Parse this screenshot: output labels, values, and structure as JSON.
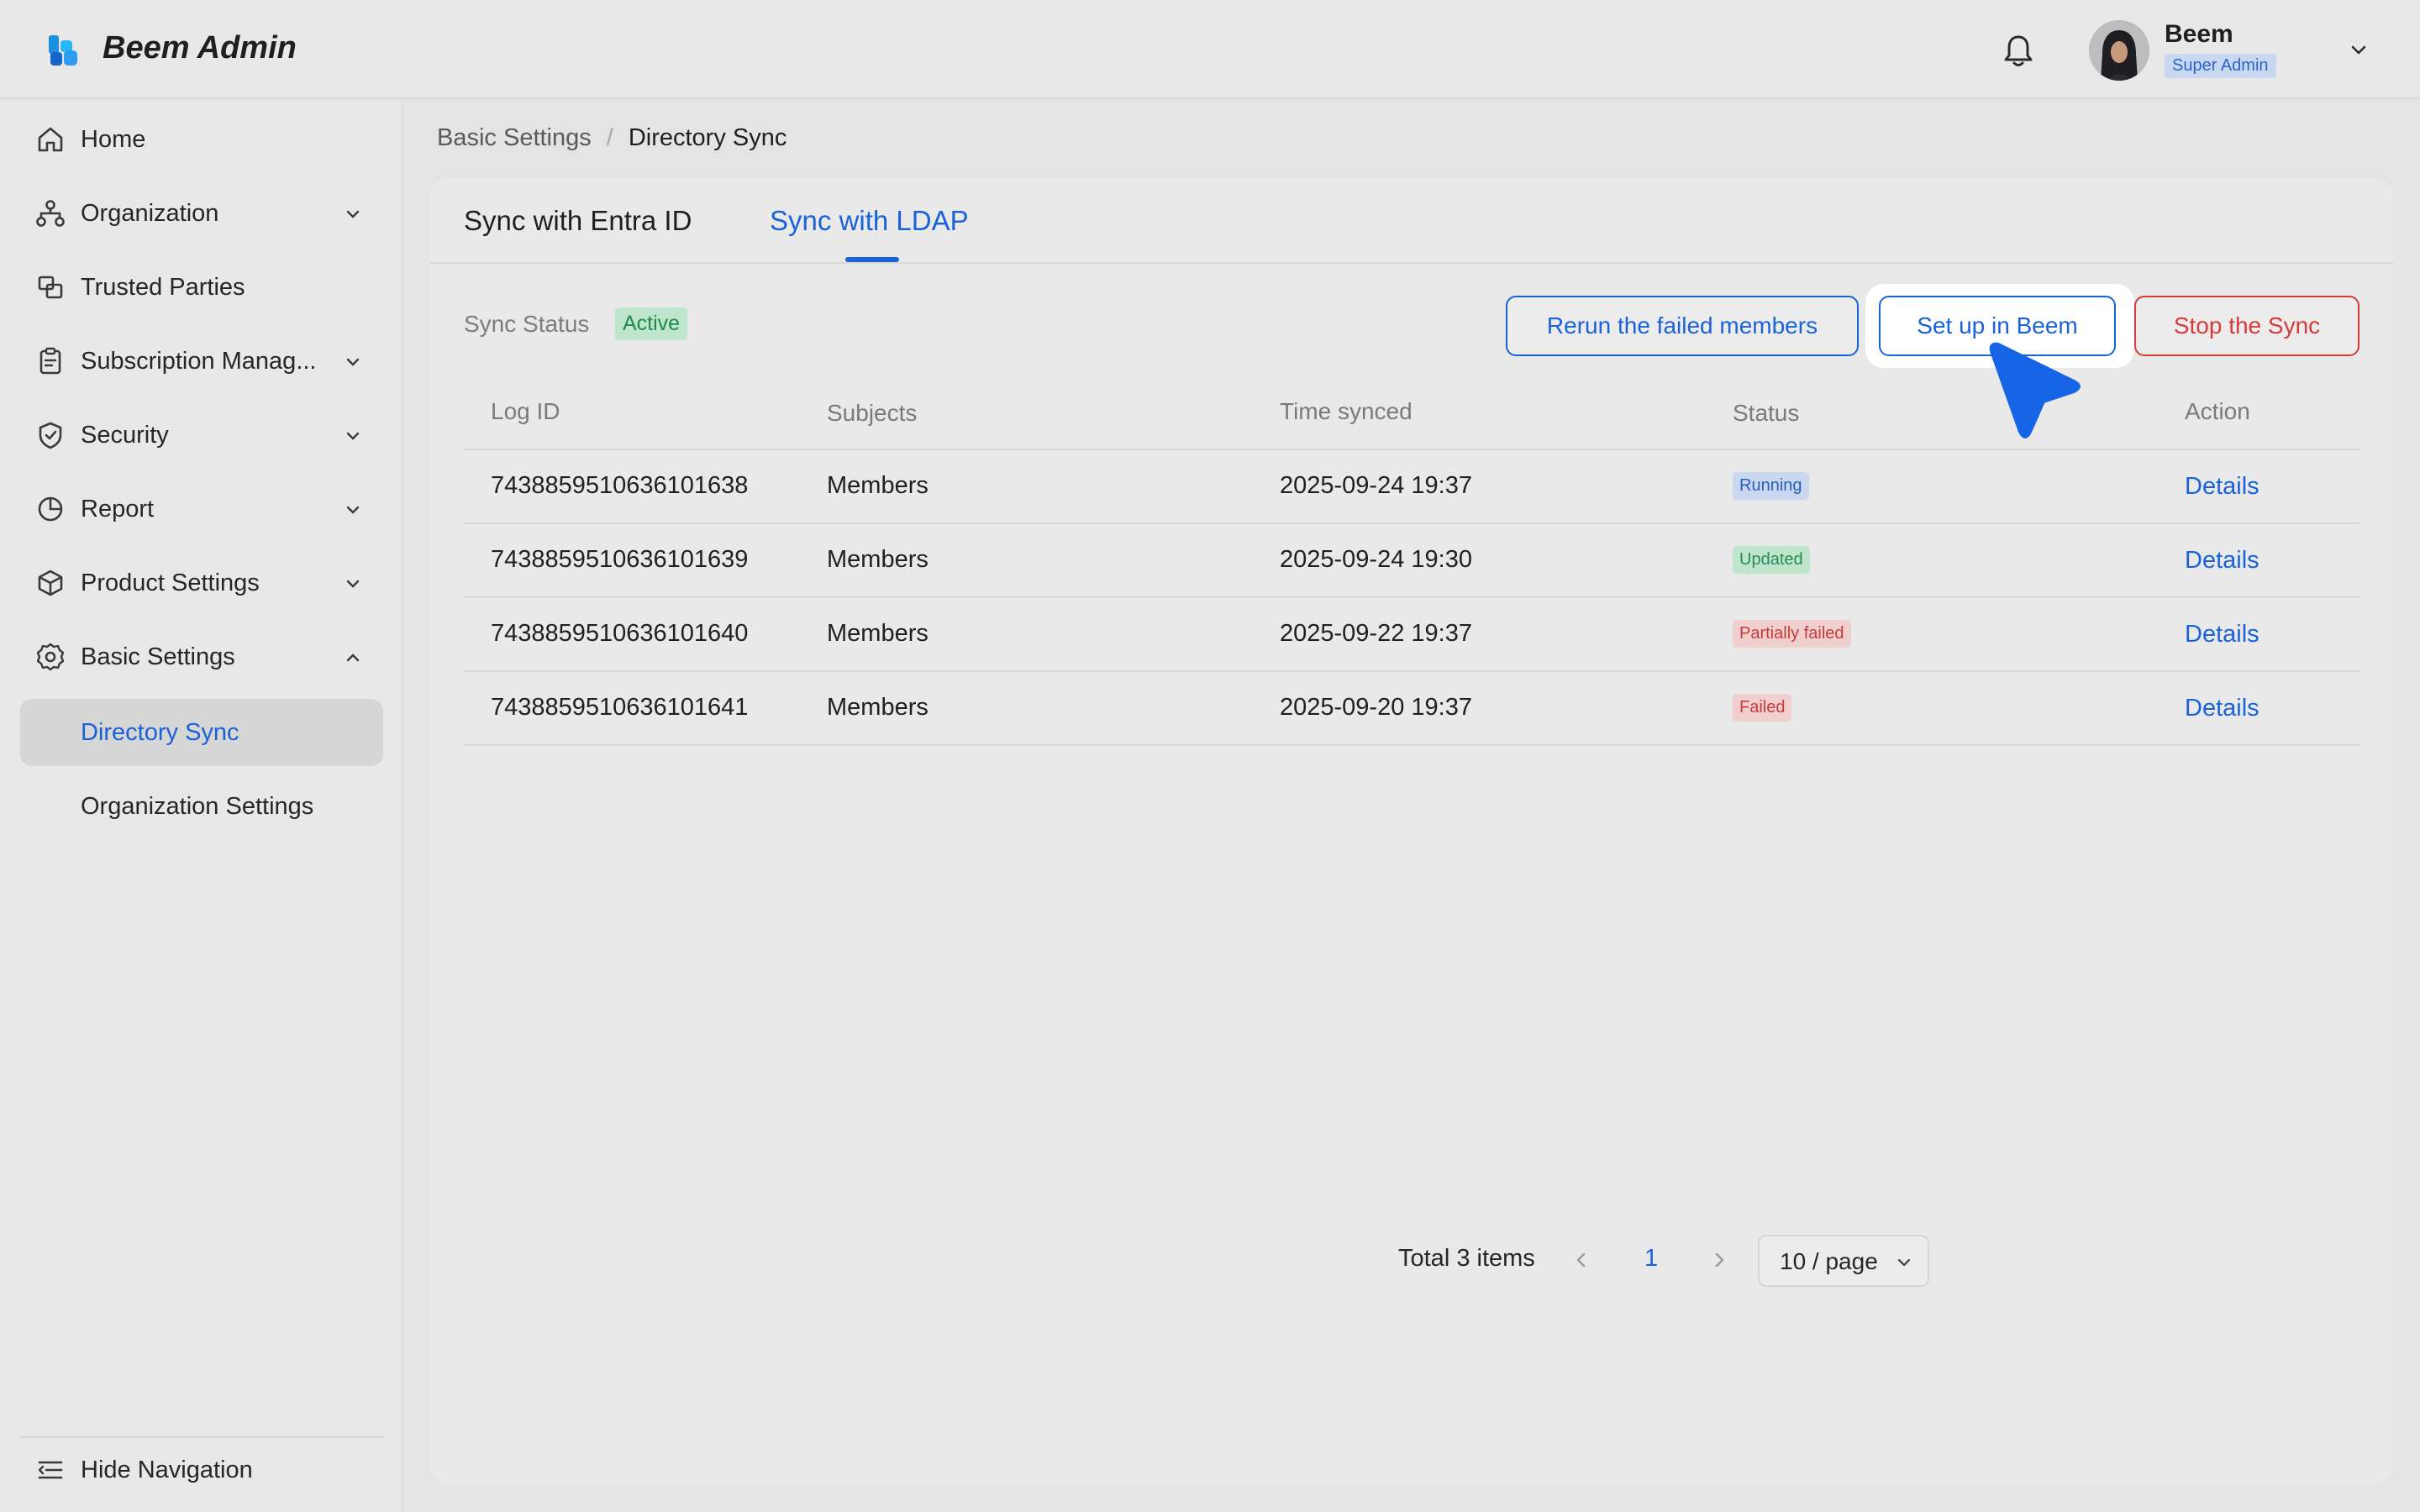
{
  "app": {
    "title": "Beem Admin"
  },
  "user": {
    "name": "Beem",
    "role": "Super Admin"
  },
  "sidebar": {
    "items": [
      {
        "label": "Home",
        "icon": "home-icon"
      },
      {
        "label": "Organization",
        "icon": "org-chart-icon"
      },
      {
        "label": "Trusted Parties",
        "icon": "trusted-parties-icon"
      },
      {
        "label": "Subscription Manag...",
        "icon": "clipboard-icon"
      },
      {
        "label": "Security",
        "icon": "shield-icon"
      },
      {
        "label": "Report",
        "icon": "pie-chart-icon"
      },
      {
        "label": "Product Settings",
        "icon": "cube-icon"
      },
      {
        "label": "Basic Settings",
        "icon": "gear-icon"
      }
    ],
    "sub_items": [
      {
        "label": "Directory Sync",
        "active": true
      },
      {
        "label": "Organization Settings",
        "active": false
      }
    ],
    "hide_nav_label": "Hide Navigation"
  },
  "breadcrumb": {
    "parent": "Basic Settings",
    "separator": "/",
    "current": "Directory Sync"
  },
  "tabs": [
    {
      "label": "Sync with Entra ID",
      "active": false
    },
    {
      "label": "Sync with LDAP",
      "active": true
    }
  ],
  "sync": {
    "status_label": "Sync Status",
    "status_value": "Active",
    "buttons": {
      "rerun": "Rerun the failed members",
      "setup": "Set up in Beem",
      "stop": "Stop the Sync"
    }
  },
  "table": {
    "headers": [
      "Log ID",
      "Subjects",
      "Time synced",
      "Status",
      "Action"
    ],
    "rows": [
      {
        "log_id": "7438859510636101638",
        "subjects": "Members",
        "time": "2025-09-24 19:37",
        "status": "Running",
        "action": "Details"
      },
      {
        "log_id": "7438859510636101639",
        "subjects": "Members",
        "time": "2025-09-24 19:30",
        "status": "Updated",
        "action": "Details"
      },
      {
        "log_id": "7438859510636101640",
        "subjects": "Members",
        "time": "2025-09-22 19:37",
        "status": "Partially failed",
        "action": "Details"
      },
      {
        "log_id": "7438859510636101641",
        "subjects": "Members",
        "time": "2025-09-20 19:37",
        "status": "Failed",
        "action": "Details"
      }
    ]
  },
  "pagination": {
    "total": "Total 3 items",
    "current_page": "1",
    "page_size": "10 / page"
  },
  "colors": {
    "accent": "#1a62d8",
    "danger": "#d63a3a",
    "success": "#1f8a4c",
    "cursor": "#1565e6"
  }
}
